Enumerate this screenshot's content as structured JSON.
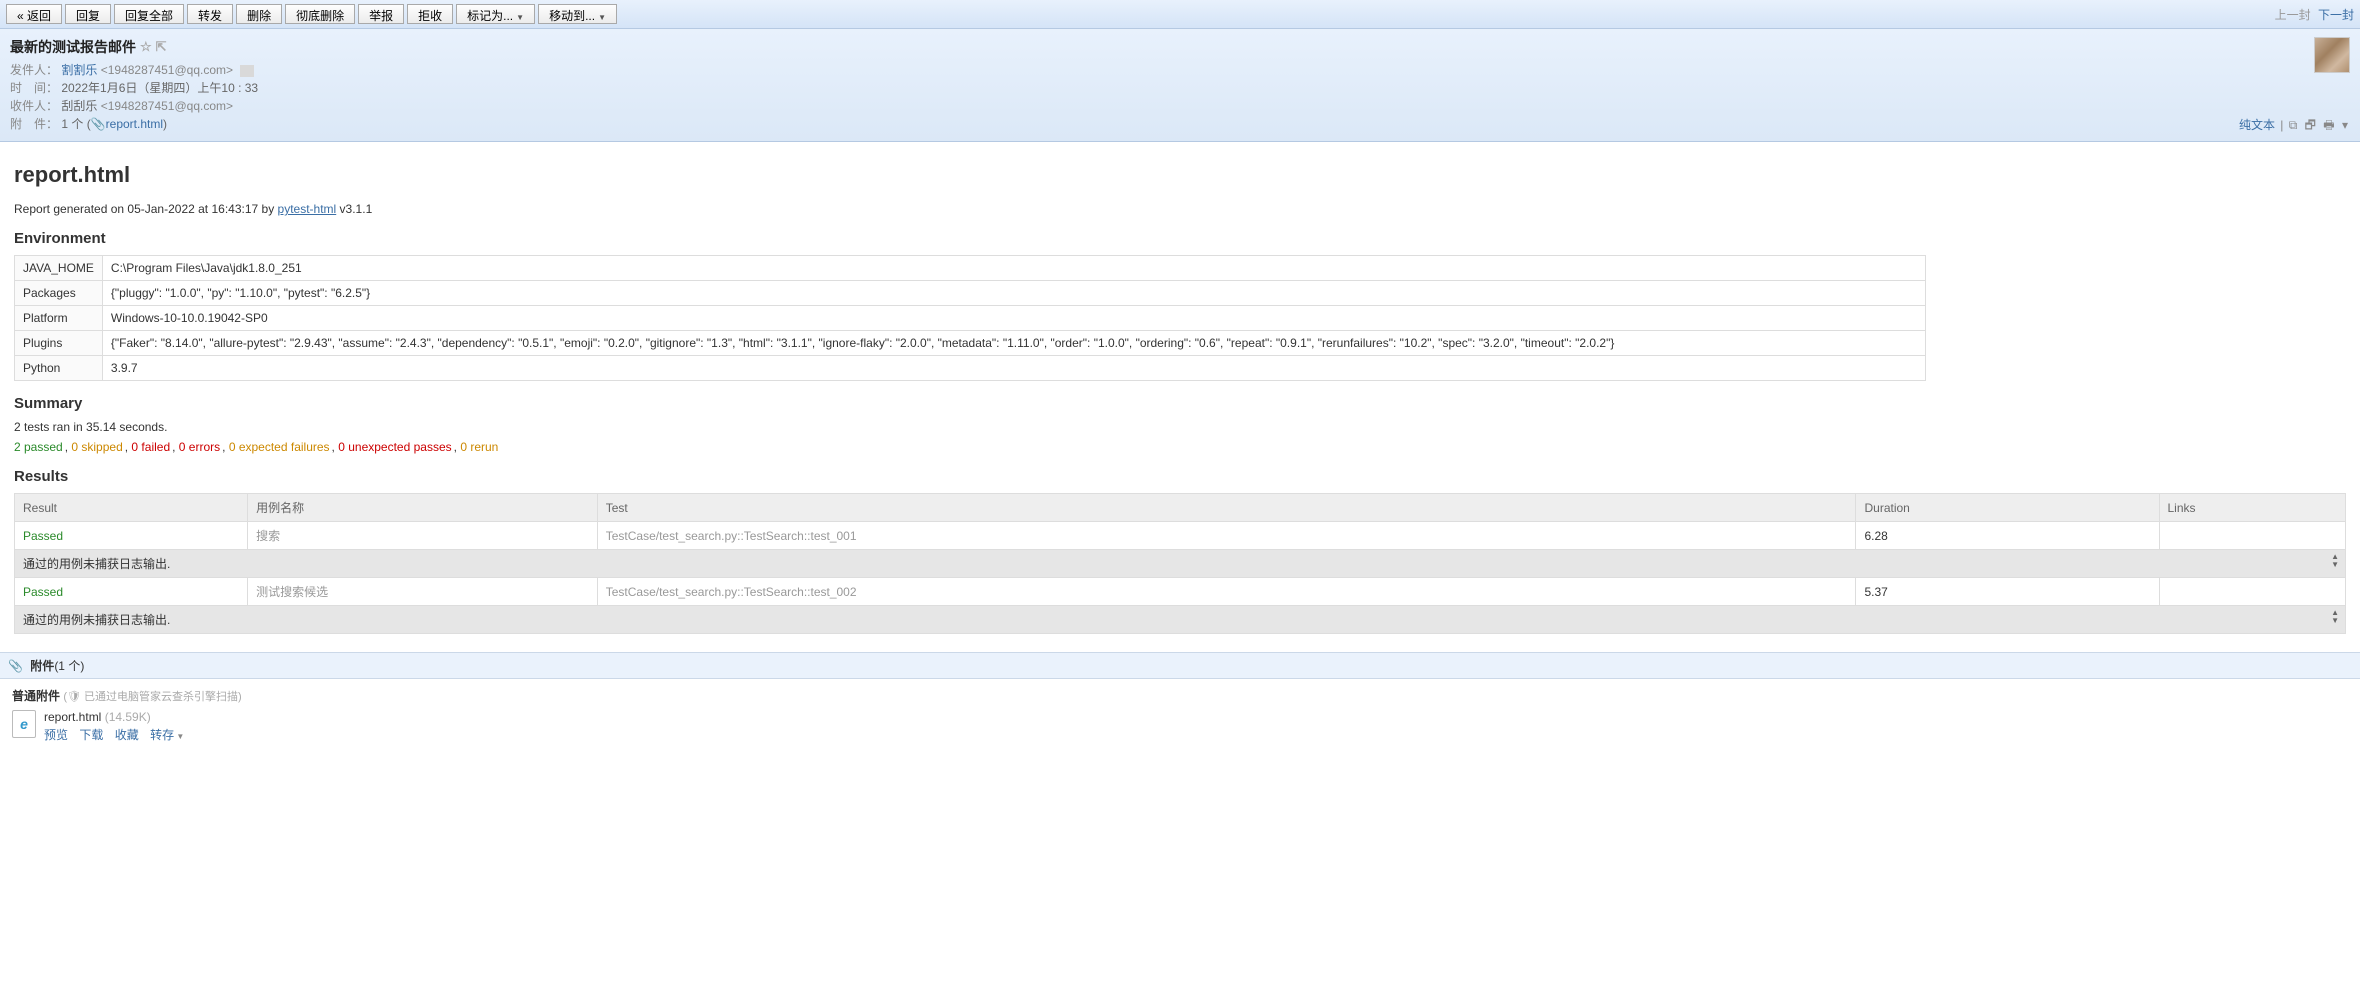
{
  "toolbar": {
    "back": "« 返回",
    "reply": "回复",
    "reply_all": "回复全部",
    "forward": "转发",
    "delete": "删除",
    "delete_perm": "彻底删除",
    "report": "举报",
    "reject": "拒收",
    "mark_as": "标记为...",
    "move_to": "移动到...",
    "prev": "上一封",
    "next": "下一封"
  },
  "email": {
    "subject": "最新的测试报告邮件",
    "from_label": "发件人：",
    "from_name": "割割乐",
    "from_addr": "<1948287451@qq.com>",
    "date_label": "时　间：",
    "date_value": "2022年1月6日（星期四）上午10 : 33",
    "to_label": "收件人：",
    "to_name": "刮刮乐",
    "to_addr": "<1948287451@qq.com>",
    "attach_label": "附　件：",
    "attach_count": "1 个 (",
    "attach_name": "report.html",
    "attach_close": ")",
    "plain_text": "纯文本",
    "icons": {
      "new_win": "⧉",
      "popout": "🗗",
      "print": "🖶",
      "arrow": "▾"
    }
  },
  "report": {
    "title": "report.html",
    "generated_prefix": "Report generated on 05-Jan-2022 at 16:43:17 by ",
    "lib_name": "pytest-html",
    "lib_version": " v3.1.1",
    "env_heading": "Environment",
    "env_rows": [
      {
        "k": "JAVA_HOME",
        "v": "C:\\Program Files\\Java\\jdk1.8.0_251"
      },
      {
        "k": "Packages",
        "v": "{\"pluggy\": \"1.0.0\", \"py\": \"1.10.0\", \"pytest\": \"6.2.5\"}"
      },
      {
        "k": "Platform",
        "v": "Windows-10-10.0.19042-SP0"
      },
      {
        "k": "Plugins",
        "v": "{\"Faker\": \"8.14.0\", \"allure-pytest\": \"2.9.43\", \"assume\": \"2.4.3\", \"dependency\": \"0.5.1\", \"emoji\": \"0.2.0\", \"gitignore\": \"1.3\", \"html\": \"3.1.1\", \"ignore-flaky\": \"2.0.0\", \"metadata\": \"1.11.0\", \"order\": \"1.0.0\", \"ordering\": \"0.6\", \"repeat\": \"0.9.1\", \"rerunfailures\": \"10.2\", \"spec\": \"3.2.0\", \"timeout\": \"2.0.2\"}"
      },
      {
        "k": "Python",
        "v": "3.9.7"
      }
    ],
    "summary_heading": "Summary",
    "summary_text": "2 tests ran in 35.14 seconds.",
    "counts": {
      "passed": "2 passed",
      "skipped": "0 skipped",
      "failed": "0 failed",
      "errors": "0 errors",
      "expected": "0 expected failures",
      "unexpected": "0 unexpected passes",
      "rerun": "0 rerun"
    },
    "results_heading": "Results",
    "columns": {
      "result": "Result",
      "name": "用例名称",
      "test": "Test",
      "duration": "Duration",
      "links": "Links"
    },
    "rows": [
      {
        "result": "Passed",
        "name": "搜索",
        "test": "TestCase/test_search.py::TestSearch::test_001",
        "duration": "6.28",
        "links": ""
      },
      {
        "result": "Passed",
        "name": "测试搜索候选",
        "test": "TestCase/test_search.py::TestSearch::test_002",
        "duration": "5.37",
        "links": ""
      }
    ],
    "log_text": "通过的用例未捕获日志输出."
  },
  "attach_bar": {
    "label": "附件",
    "count": "(1 个)"
  },
  "attach_section": {
    "heading": "普通附件",
    "hint": "(🛡 已通过电脑管家云查杀引擎扫描)",
    "file_name": "report.html",
    "file_size": "(14.59K)",
    "preview": "预览",
    "download": "下载",
    "favorite": "收藏",
    "save_to": "转存"
  }
}
